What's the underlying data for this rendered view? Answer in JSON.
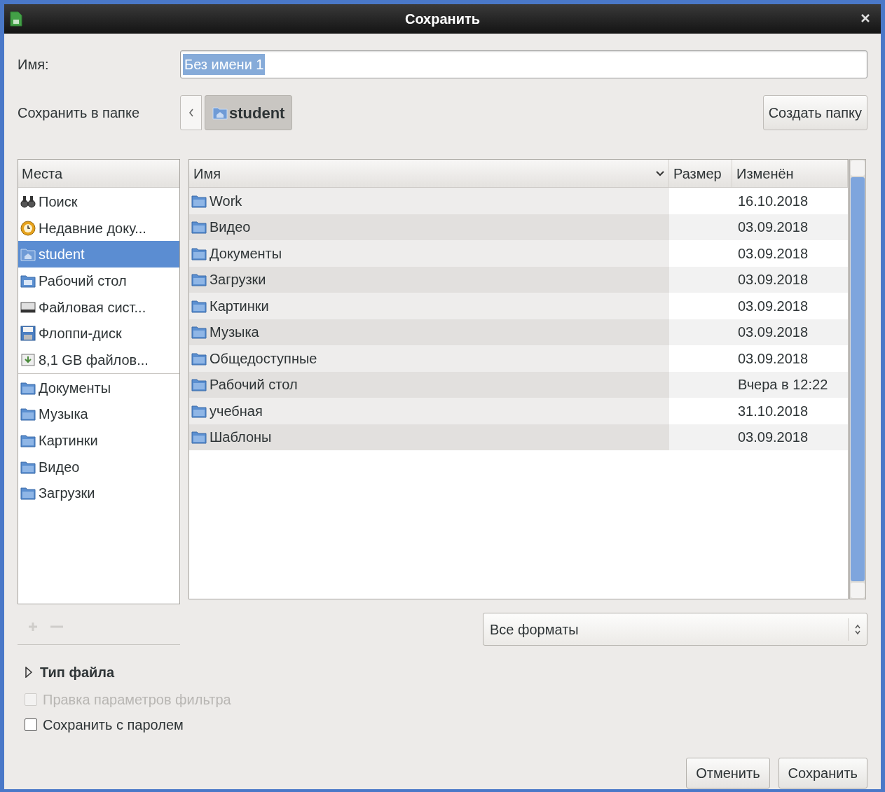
{
  "window": {
    "title": "Сохранить"
  },
  "name_field": {
    "label": "Имя:",
    "value": "Без имени 1",
    "text_selected": true
  },
  "location": {
    "label": "Сохранить в папке",
    "path": [
      {
        "label": "student",
        "selected": true
      }
    ]
  },
  "create_folder_button": "Создать папку",
  "places": {
    "header": "Места",
    "groups": [
      {
        "items": [
          {
            "label": "Поиск",
            "kind": "search",
            "selected": false
          },
          {
            "label": "Недавние доку...",
            "kind": "recent",
            "selected": false
          },
          {
            "label": "student",
            "kind": "home",
            "selected": true
          },
          {
            "label": "Рабочий стол",
            "kind": "desktop",
            "selected": false
          },
          {
            "label": "Файловая сист...",
            "kind": "filesystem",
            "selected": false
          },
          {
            "label": "Флоппи-диск",
            "kind": "floppy",
            "selected": false
          },
          {
            "label": "8,1 GB файлов...",
            "kind": "drive",
            "selected": false
          }
        ]
      },
      {
        "items": [
          {
            "label": "Документы",
            "kind": "folder",
            "selected": false
          },
          {
            "label": "Музыка",
            "kind": "folder",
            "selected": false
          },
          {
            "label": "Картинки",
            "kind": "folder",
            "selected": false
          },
          {
            "label": "Видео",
            "kind": "folder",
            "selected": false
          },
          {
            "label": "Загрузки",
            "kind": "folder",
            "selected": false
          }
        ]
      }
    ]
  },
  "files": {
    "columns": [
      {
        "label": "Имя",
        "sorted": true
      },
      {
        "label": "Размер",
        "sorted": false
      },
      {
        "label": "Изменён",
        "sorted": false
      }
    ],
    "rows": [
      {
        "name": "Work",
        "modified": "16.10.2018"
      },
      {
        "name": "Видео",
        "modified": "03.09.2018"
      },
      {
        "name": "Документы",
        "modified": "03.09.2018"
      },
      {
        "name": "Загрузки",
        "modified": "03.09.2018"
      },
      {
        "name": "Картинки",
        "modified": "03.09.2018"
      },
      {
        "name": "Музыка",
        "modified": "03.09.2018"
      },
      {
        "name": "Общедоступные",
        "modified": "03.09.2018"
      },
      {
        "name": "Рабочий стол",
        "modified": "Вчера в 12:22"
      },
      {
        "name": "учебная",
        "modified": "31.10.2018"
      },
      {
        "name": "Шаблоны",
        "modified": "03.09.2018"
      }
    ]
  },
  "filter": {
    "value": "Все форматы"
  },
  "file_type": {
    "label": "Тип файла",
    "expanded": false
  },
  "options": [
    {
      "label": "Правка параметров фильтра",
      "checked": false,
      "disabled": true
    },
    {
      "label": "Сохранить с паролем",
      "checked": false,
      "disabled": false
    }
  ],
  "buttons": [
    {
      "label": "Отменить"
    },
    {
      "label": "Сохранить"
    }
  ]
}
